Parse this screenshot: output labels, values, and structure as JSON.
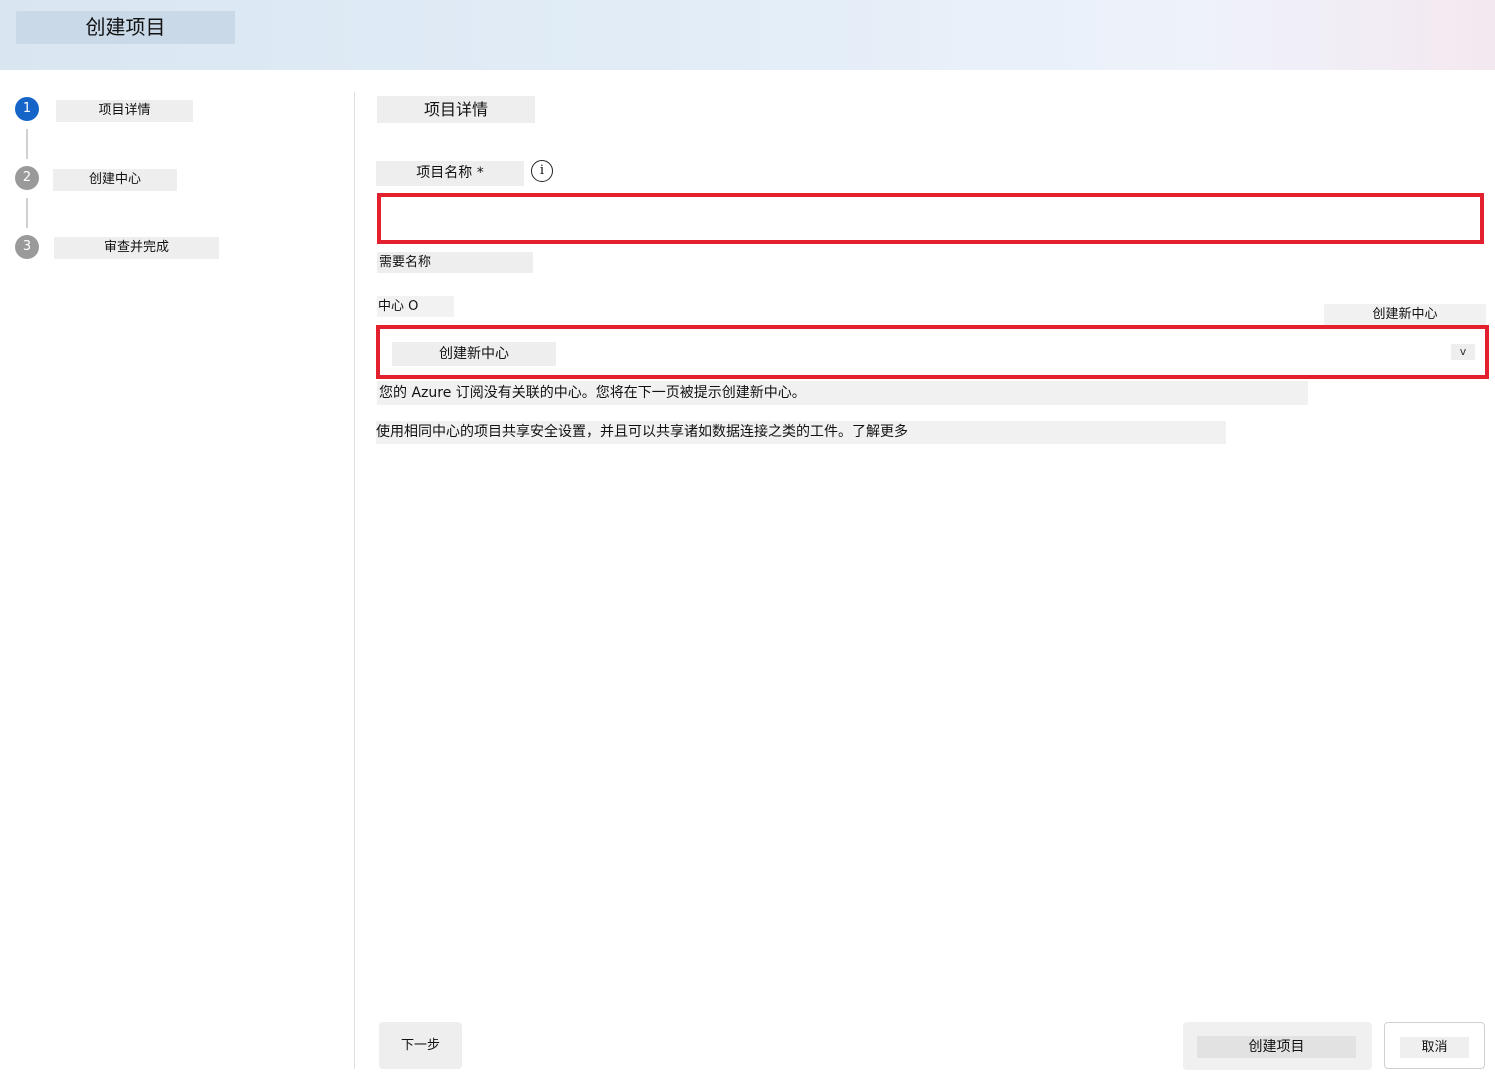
{
  "header": {
    "title": "创建项目"
  },
  "steps": [
    {
      "number": "1",
      "label": "项目详情",
      "status": "active"
    },
    {
      "number": "2",
      "label": "创建中心",
      "status": "inactive"
    },
    {
      "number": "3",
      "label": "审查并完成",
      "status": "inactive"
    }
  ],
  "form": {
    "section_title": "项目详情",
    "name_label": "项目名称 *",
    "info_icon": "i",
    "name_value": "",
    "name_error": "需要名称",
    "hub_label": "中心 O",
    "new_hub_link": "创建新中心",
    "hub_selected": "创建新中心",
    "hub_chevron": "v",
    "note_no_hub": "您的 Azure 订阅没有关联的中心。您将在下一页被提示创建新中心。",
    "note_share": "使用相同中心的项目共享安全设置，并且可以共享诸如数据连接之类的工件。了解更多"
  },
  "footer": {
    "next_label": "下一步",
    "create_label": "创建项目",
    "cancel_label": "取消"
  },
  "colors": {
    "accent": "#1565c8",
    "error_border": "#e3202e"
  }
}
